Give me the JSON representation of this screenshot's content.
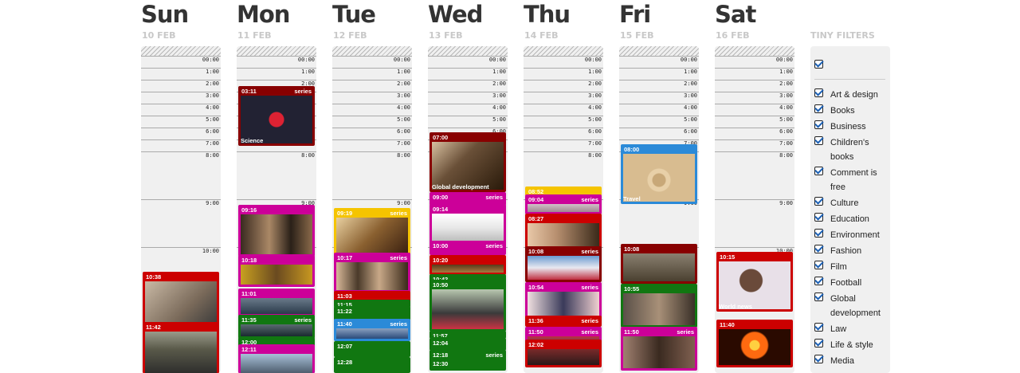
{
  "days": [
    {
      "name": "Sun",
      "date": "10 FEB"
    },
    {
      "name": "Mon",
      "date": "11 FEB"
    },
    {
      "name": "Tue",
      "date": "12 FEB"
    },
    {
      "name": "Wed",
      "date": "13 FEB"
    },
    {
      "name": "Thu",
      "date": "14 FEB"
    },
    {
      "name": "Fri",
      "date": "15 FEB"
    },
    {
      "name": "Sat",
      "date": "16 FEB"
    }
  ],
  "hour_labels": [
    "00:00",
    "1:00",
    "2:00",
    "3:00",
    "4:00",
    "5:00",
    "6:00",
    "7:00",
    "8:00",
    "9:00",
    "10:00"
  ],
  "filters": {
    "title": "TINY FILTERS",
    "select_all_checked": true,
    "items": [
      "Art & design",
      "Books",
      "Business",
      "Children's books",
      "Comment is free",
      "Culture",
      "Education",
      "Environment",
      "Fashion",
      "Film",
      "Football",
      "Global development",
      "Law",
      "Life & style",
      "Media"
    ]
  },
  "colors": {
    "red": "#cc0000",
    "magenta": "#cc0099",
    "green": "#117711",
    "yellow": "#f5c400",
    "blue": "#2b8ad8",
    "dark_red": "#880000",
    "purple": "#6633aa"
  },
  "cards": [
    {
      "day": 0,
      "time": "10:38",
      "series": "",
      "caption": ""
    },
    {
      "day": 0,
      "time": "11:42",
      "series": "",
      "caption": ""
    },
    {
      "day": 1,
      "time": "03:11",
      "series": "series",
      "caption": "Science"
    },
    {
      "day": 1,
      "time": "09:16",
      "series": "",
      "caption": ""
    },
    {
      "day": 1,
      "time": "10:18",
      "series": "",
      "caption": ""
    },
    {
      "day": 1,
      "time": "11:01",
      "series": "",
      "caption": ""
    },
    {
      "day": 1,
      "time": "11:35",
      "series": "series",
      "caption": ""
    },
    {
      "day": 1,
      "time": "12:00",
      "series": "",
      "caption": ""
    },
    {
      "day": 1,
      "time": "12:11",
      "series": "",
      "caption": ""
    },
    {
      "day": 2,
      "time": "09:19",
      "series": "series",
      "caption": ""
    },
    {
      "day": 2,
      "time": "10:17",
      "series": "series",
      "caption": ""
    },
    {
      "day": 2,
      "time": "11:03",
      "series": "",
      "caption": ""
    },
    {
      "day": 2,
      "time": "11:15",
      "series": "",
      "caption": ""
    },
    {
      "day": 2,
      "time": "11:22",
      "series": "",
      "caption": ""
    },
    {
      "day": 2,
      "time": "11:40",
      "series": "series",
      "caption": ""
    },
    {
      "day": 2,
      "time": "12:07",
      "series": "",
      "caption": ""
    },
    {
      "day": 2,
      "time": "12:28",
      "series": "",
      "caption": ""
    },
    {
      "day": 3,
      "time": "07:00",
      "series": "",
      "caption": "Global development"
    },
    {
      "day": 3,
      "time": "09:00",
      "series": "series",
      "caption": ""
    },
    {
      "day": 3,
      "time": "09:14",
      "series": "",
      "caption": ""
    },
    {
      "day": 3,
      "time": "10:00",
      "series": "series",
      "caption": ""
    },
    {
      "day": 3,
      "time": "10:20",
      "series": "",
      "caption": ""
    },
    {
      "day": 3,
      "time": "10:42",
      "series": "",
      "caption": ""
    },
    {
      "day": 3,
      "time": "10:50",
      "series": "",
      "caption": ""
    },
    {
      "day": 3,
      "time": "11:57",
      "series": "",
      "caption": ""
    },
    {
      "day": 3,
      "time": "12:04",
      "series": "",
      "caption": ""
    },
    {
      "day": 3,
      "time": "12:18",
      "series": "series",
      "caption": ""
    },
    {
      "day": 3,
      "time": "12:30",
      "series": "",
      "caption": ""
    },
    {
      "day": 4,
      "time": "08:52",
      "series": "",
      "caption": ""
    },
    {
      "day": 4,
      "time": "09:04",
      "series": "series",
      "caption": ""
    },
    {
      "day": 4,
      "time": "08:27",
      "series": "",
      "caption": ""
    },
    {
      "day": 4,
      "time": "10:08",
      "series": "series",
      "caption": ""
    },
    {
      "day": 4,
      "time": "10:54",
      "series": "series",
      "caption": ""
    },
    {
      "day": 4,
      "time": "11:36",
      "series": "series",
      "caption": ""
    },
    {
      "day": 4,
      "time": "11:50",
      "series": "series",
      "caption": ""
    },
    {
      "day": 4,
      "time": "12:02",
      "series": "",
      "caption": ""
    },
    {
      "day": 5,
      "time": "08:00",
      "series": "",
      "caption": "Travel"
    },
    {
      "day": 5,
      "time": "10:08",
      "series": "",
      "caption": ""
    },
    {
      "day": 5,
      "time": "10:55",
      "series": "",
      "caption": ""
    },
    {
      "day": 5,
      "time": "11:50",
      "series": "series",
      "caption": ""
    },
    {
      "day": 6,
      "time": "10:15",
      "series": "",
      "caption": "World news"
    },
    {
      "day": 6,
      "time": "11:40",
      "series": "",
      "caption": ""
    }
  ]
}
